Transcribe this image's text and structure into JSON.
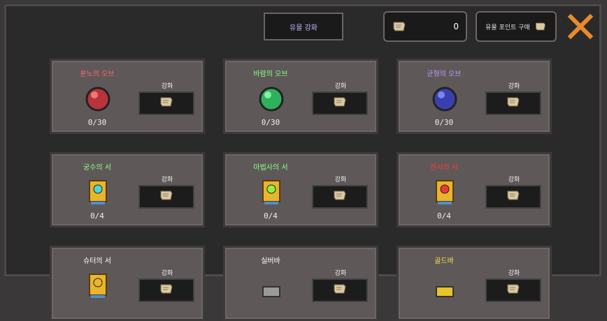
{
  "header": {
    "relic_upgrade_label": "유물 강화",
    "scroll_count": "0",
    "buy_points_label": "유물 포인트 구매"
  },
  "colors": {
    "red": "#ff6b6b",
    "green": "#6fff7f",
    "purple": "#b99cff",
    "pink": "#ff3c3c",
    "gold": "#ffe04f"
  },
  "cards": [
    {
      "title": "분노의 오브",
      "count": "0/30",
      "upgrade": "강화",
      "title_color": "#ff6b6b",
      "icon": "red-orb-icon"
    },
    {
      "title": "바람의 오브",
      "count": "0/30",
      "upgrade": "강화",
      "title_color": "#8dff8d",
      "icon": "green-orb-icon"
    },
    {
      "title": "균형의 오브",
      "count": "0/30",
      "upgrade": "강화",
      "title_color": "#b99cff",
      "icon": "blue-orb-icon"
    },
    {
      "title": "궁수의 서",
      "count": "0/4",
      "upgrade": "강화",
      "title_color": "#8dff8d",
      "icon": "cyan-book-icon"
    },
    {
      "title": "마법사의 서",
      "count": "0/4",
      "upgrade": "강화",
      "title_color": "#8dff8d",
      "icon": "green-book-icon"
    },
    {
      "title": "전사의 서",
      "count": "0/4",
      "upgrade": "강화",
      "title_color": "#ff3c3c",
      "icon": "red-book-icon"
    },
    {
      "title": "슈터의 서",
      "count": "",
      "upgrade": "강화",
      "title_color": "#ffffff",
      "icon": "book-icon"
    },
    {
      "title": "실버바",
      "count": "",
      "upgrade": "강화",
      "title_color": "#ffffff",
      "icon": "silver-bar-icon"
    },
    {
      "title": "골드바",
      "count": "",
      "upgrade": "강화",
      "title_color": "#ffe04f",
      "icon": "gold-bar-icon"
    }
  ]
}
